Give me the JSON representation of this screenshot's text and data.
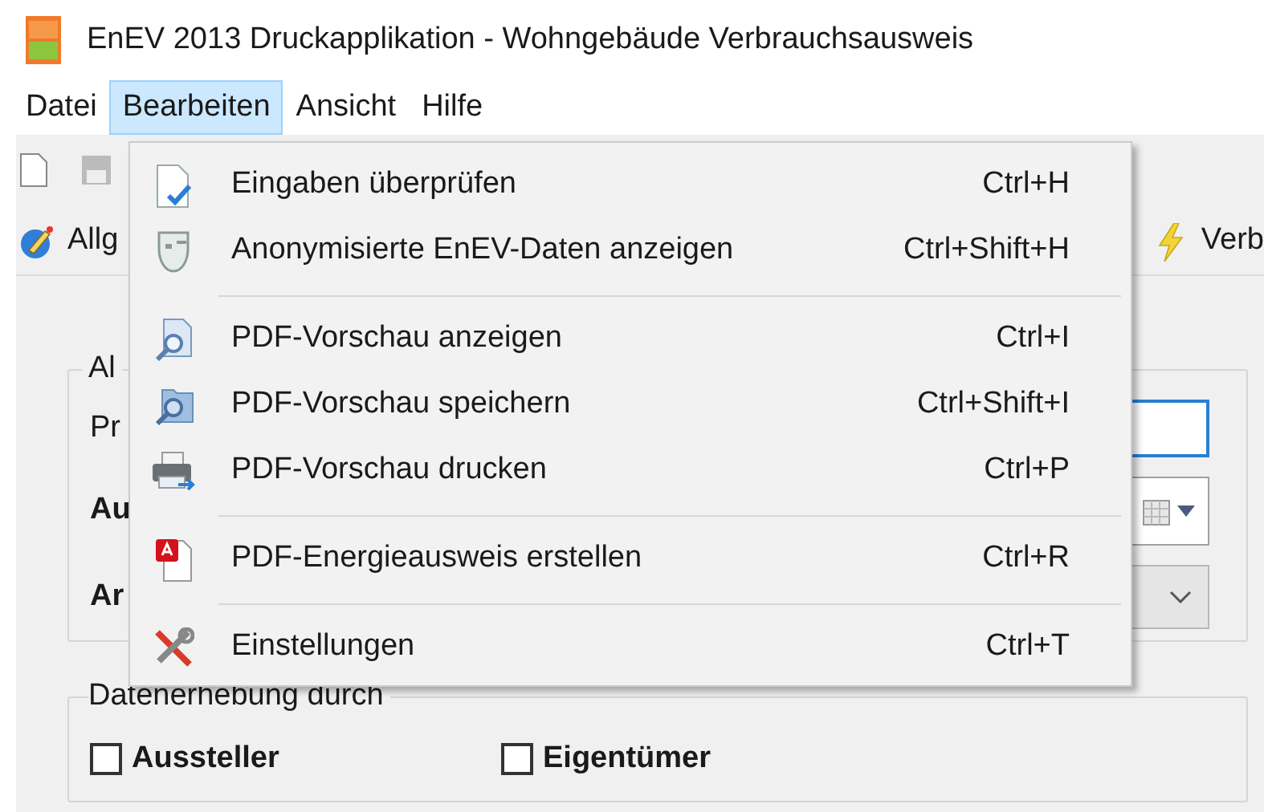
{
  "window": {
    "title": "EnEV 2013 Druckapplikation - Wohngebäude Verbrauchsausweis"
  },
  "menubar": [
    {
      "label": "Datei",
      "selected": false
    },
    {
      "label": "Bearbeiten",
      "selected": true
    },
    {
      "label": "Ansicht",
      "selected": false
    },
    {
      "label": "Hilfe",
      "selected": false
    }
  ],
  "tabs": [
    {
      "label": "Allg"
    },
    {
      "label": "Verb"
    }
  ],
  "menu": [
    {
      "kind": "item",
      "label": "Eingaben überprüfen",
      "shortcut": "Ctrl+H"
    },
    {
      "kind": "item",
      "label": "Anonymisierte EnEV-Daten anzeigen",
      "shortcut": "Ctrl+Shift+H"
    },
    {
      "kind": "separator"
    },
    {
      "kind": "item",
      "label": "PDF-Vorschau anzeigen",
      "shortcut": "Ctrl+I"
    },
    {
      "kind": "item",
      "label": "PDF-Vorschau speichern",
      "shortcut": "Ctrl+Shift+I"
    },
    {
      "kind": "item",
      "label": "PDF-Vorschau drucken",
      "shortcut": "Ctrl+P"
    },
    {
      "kind": "separator"
    },
    {
      "kind": "item",
      "label": "PDF-Energieausweis erstellen",
      "shortcut": "Ctrl+R"
    },
    {
      "kind": "separator"
    },
    {
      "kind": "item",
      "label": "Einstellungen",
      "shortcut": "Ctrl+T"
    }
  ],
  "group_1": {
    "title": "Al",
    "rows": [
      {
        "label": "Pr",
        "bold": false
      },
      {
        "label": "Au",
        "bold": true
      },
      {
        "label": "Ar",
        "bold": true
      }
    ]
  },
  "group_2": {
    "title": "Datenerhebung durch",
    "checkboxes": [
      {
        "label": "Aussteller",
        "checked": false
      },
      {
        "label": "Eigentümer",
        "checked": false
      }
    ]
  }
}
